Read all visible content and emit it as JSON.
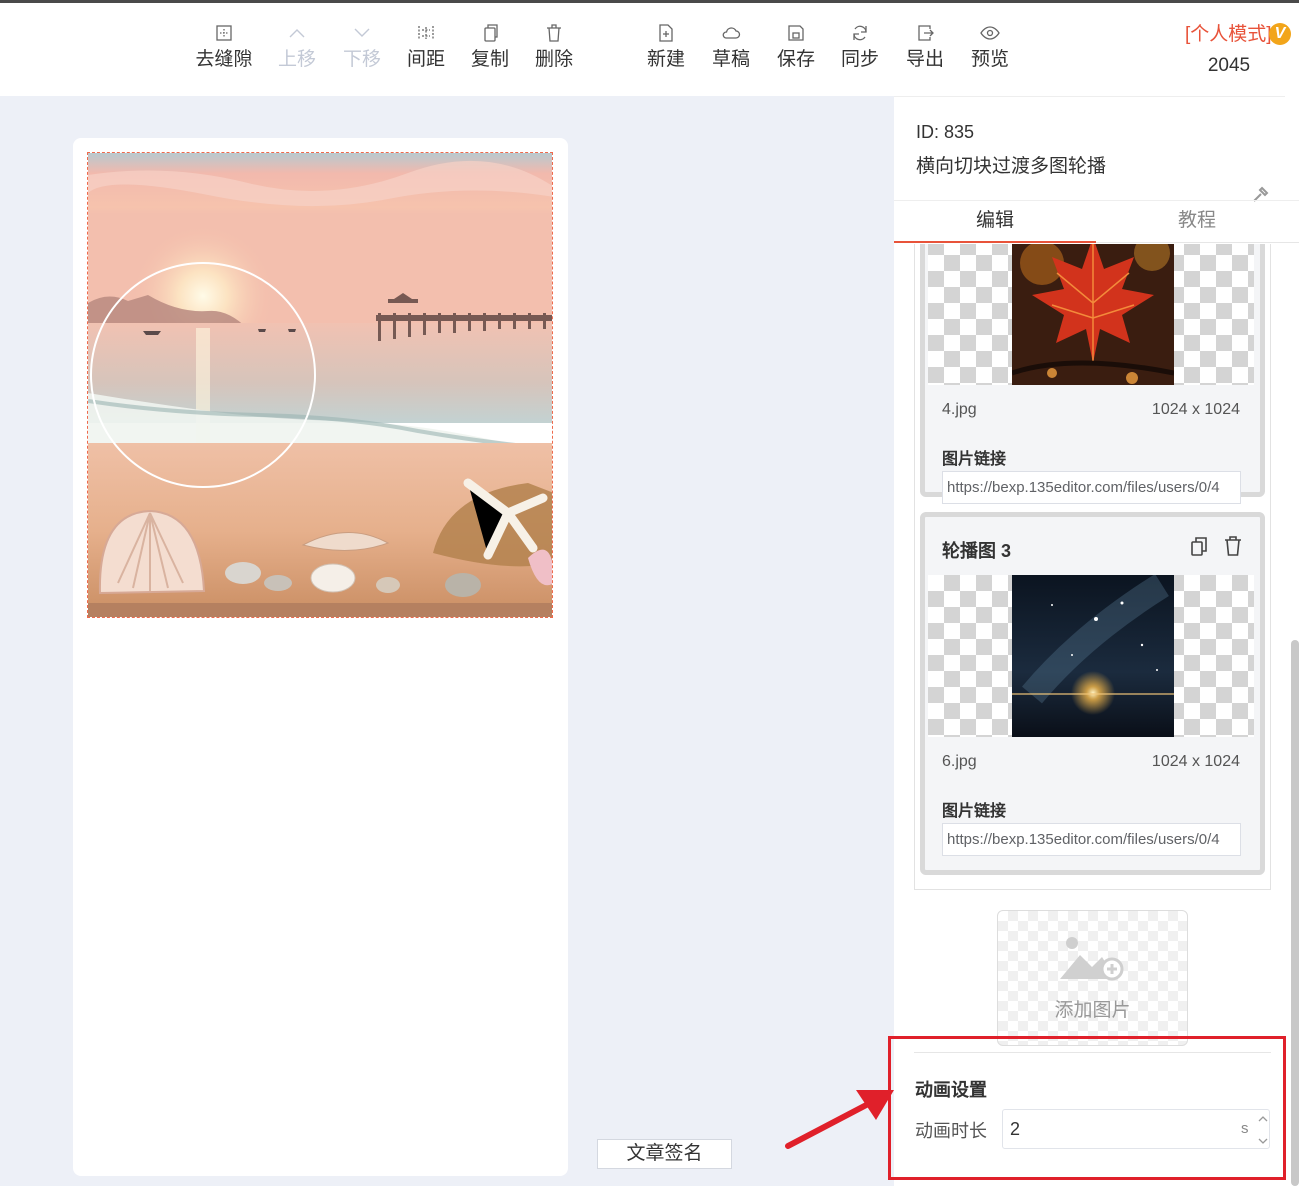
{
  "toolbar": {
    "tools": [
      {
        "id": "fill-gap",
        "label": "去缝隙",
        "icon": "fill-gap-icon",
        "enabled": true
      },
      {
        "id": "move-up",
        "label": "上移",
        "icon": "arrow-up-icon",
        "enabled": false
      },
      {
        "id": "move-down",
        "label": "下移",
        "icon": "arrow-down-icon",
        "enabled": false
      },
      {
        "id": "spacing",
        "label": "间距",
        "icon": "spacing-icon",
        "enabled": true
      },
      {
        "id": "copy",
        "label": "复制",
        "icon": "copy-icon",
        "enabled": true
      },
      {
        "id": "delete",
        "label": "删除",
        "icon": "trash-icon",
        "enabled": true
      },
      {
        "id": "new",
        "label": "新建",
        "icon": "new-file-icon",
        "enabled": true
      },
      {
        "id": "draft",
        "label": "草稿",
        "icon": "cloud-icon",
        "enabled": true
      },
      {
        "id": "save",
        "label": "保存",
        "icon": "save-icon",
        "enabled": true
      },
      {
        "id": "sync",
        "label": "同步",
        "icon": "sync-icon",
        "enabled": true
      },
      {
        "id": "export",
        "label": "导出",
        "icon": "export-icon",
        "enabled": true
      },
      {
        "id": "preview",
        "label": "预览",
        "icon": "eye-icon",
        "enabled": true
      }
    ],
    "mode_label": "[个人模式]",
    "vip_badge": "V",
    "count": "2045"
  },
  "canvas": {
    "signature_button": "文章签名"
  },
  "panel": {
    "component_id": "ID: 835",
    "component_name": "横向切块过渡多图轮播",
    "tabs": [
      {
        "label": "编辑",
        "active": true
      },
      {
        "label": "教程",
        "active": false
      }
    ],
    "items": [
      {
        "title": "",
        "file_name": "4.jpg",
        "dimensions": "1024 x 1024",
        "link_label": "图片链接",
        "link_value": "https://bexp.135editor.com/files/users/0/4"
      },
      {
        "title": "轮播图 3",
        "file_name": "6.jpg",
        "dimensions": "1024 x 1024",
        "link_label": "图片链接",
        "link_value": "https://bexp.135editor.com/files/users/0/4"
      }
    ],
    "add_image_label": "添加图片",
    "animation": {
      "section_title": "动画设置",
      "duration_label": "动画时长",
      "duration_value": "2",
      "duration_unit": "s"
    }
  },
  "colors": {
    "accent": "#e8533a",
    "annotation": "#e0202a",
    "vip": "#f2a51a",
    "canvas_bg": "#edf0f7"
  }
}
